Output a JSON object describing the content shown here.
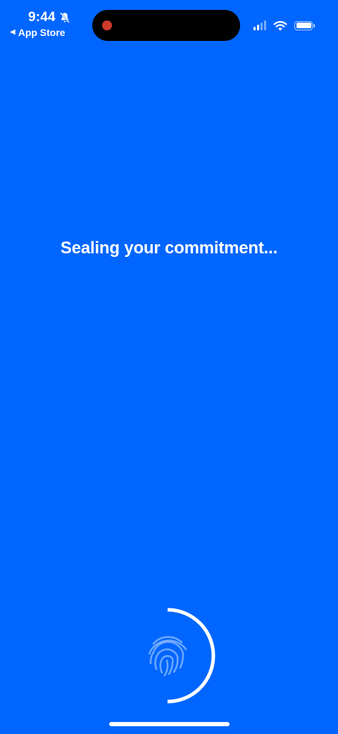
{
  "status_bar": {
    "time": "9:44",
    "back_label": "App Store",
    "back_arrow": "◀",
    "icons": [
      "bell-slash-icon",
      "cellular-signal-icon",
      "wifi-icon",
      "battery-icon"
    ],
    "recording_indicator_color": "#D03A2C"
  },
  "main": {
    "message": "Sealing your commitment..."
  },
  "progress": {
    "fraction": 0.5,
    "icon": "fingerprint-icon"
  },
  "colors": {
    "background": "#0066FF",
    "foreground": "#FFFFFF"
  }
}
